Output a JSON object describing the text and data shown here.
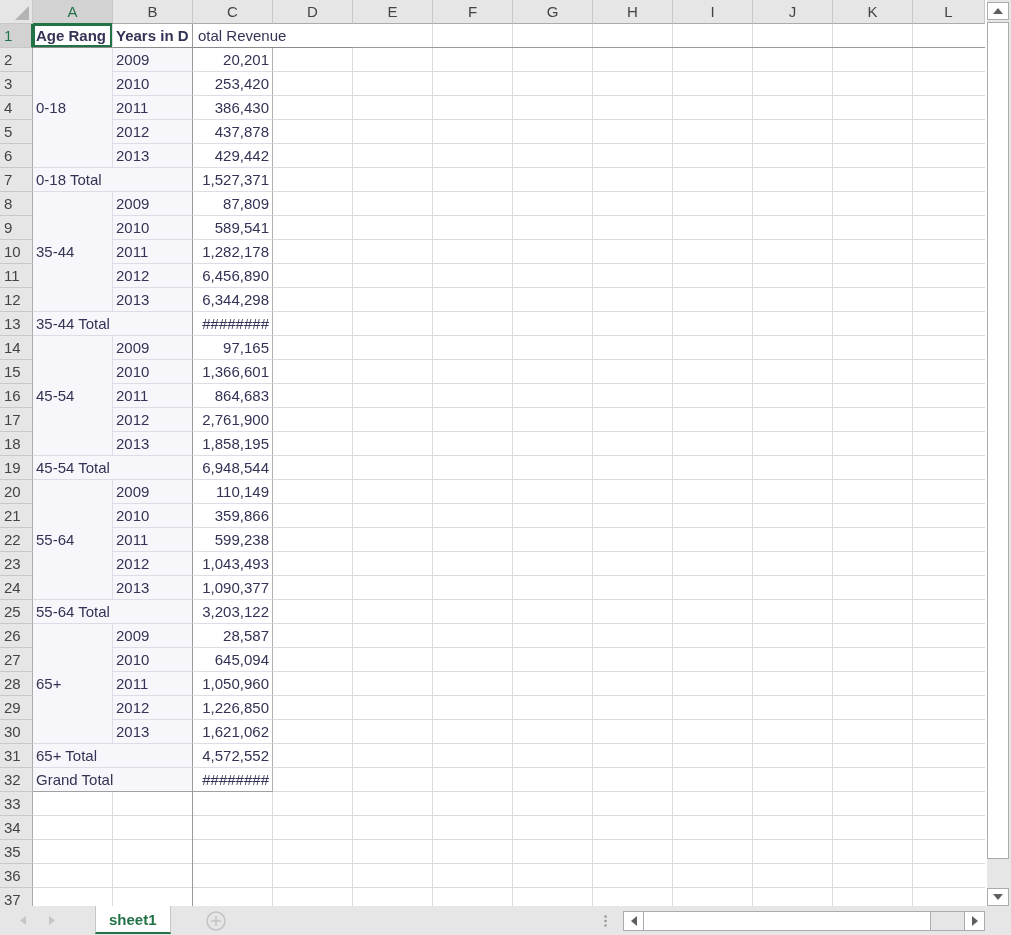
{
  "column_headers": [
    "A",
    "B",
    "C",
    "D",
    "E",
    "F",
    "G",
    "H",
    "I",
    "J",
    "K",
    "L"
  ],
  "header_row": {
    "row_number": "1",
    "cells": [
      {
        "text": "Age Rang",
        "selected": true
      },
      {
        "text": "Years in D",
        "selected": false
      },
      {
        "text": "otal Revenue",
        "selected": false
      }
    ]
  },
  "groups": [
    {
      "label": "0-18",
      "rows": [
        {
          "row_number": "2",
          "year": "2009",
          "value": "20,201"
        },
        {
          "row_number": "3",
          "year": "2010",
          "value": "253,420"
        },
        {
          "row_number": "4",
          "year": "2011",
          "value": "386,430"
        },
        {
          "row_number": "5",
          "year": "2012",
          "value": "437,878"
        },
        {
          "row_number": "6",
          "year": "2013",
          "value": "429,442"
        }
      ],
      "total": {
        "row_number": "7",
        "label": "0-18 Total",
        "value": "1,527,371"
      }
    },
    {
      "label": "35-44",
      "rows": [
        {
          "row_number": "8",
          "year": "2009",
          "value": "87,809"
        },
        {
          "row_number": "9",
          "year": "2010",
          "value": "589,541"
        },
        {
          "row_number": "10",
          "year": "2011",
          "value": "1,282,178"
        },
        {
          "row_number": "11",
          "year": "2012",
          "value": "6,456,890"
        },
        {
          "row_number": "12",
          "year": "2013",
          "value": "6,344,298"
        }
      ],
      "total": {
        "row_number": "13",
        "label": "35-44 Total",
        "value": "########"
      }
    },
    {
      "label": "45-54",
      "rows": [
        {
          "row_number": "14",
          "year": "2009",
          "value": "97,165"
        },
        {
          "row_number": "15",
          "year": "2010",
          "value": "1,366,601"
        },
        {
          "row_number": "16",
          "year": "2011",
          "value": "864,683"
        },
        {
          "row_number": "17",
          "year": "2012",
          "value": "2,761,900"
        },
        {
          "row_number": "18",
          "year": "2013",
          "value": "1,858,195"
        }
      ],
      "total": {
        "row_number": "19",
        "label": "45-54 Total",
        "value": "6,948,544"
      }
    },
    {
      "label": "55-64",
      "rows": [
        {
          "row_number": "20",
          "year": "2009",
          "value": "110,149"
        },
        {
          "row_number": "21",
          "year": "2010",
          "value": "359,866"
        },
        {
          "row_number": "22",
          "year": "2011",
          "value": "599,238"
        },
        {
          "row_number": "23",
          "year": "2012",
          "value": "1,043,493"
        },
        {
          "row_number": "24",
          "year": "2013",
          "value": "1,090,377"
        }
      ],
      "total": {
        "row_number": "25",
        "label": "55-64 Total",
        "value": "3,203,122"
      }
    },
    {
      "label": "65+",
      "rows": [
        {
          "row_number": "26",
          "year": "2009",
          "value": "28,587"
        },
        {
          "row_number": "27",
          "year": "2010",
          "value": "645,094"
        },
        {
          "row_number": "28",
          "year": "2011",
          "value": "1,050,960"
        },
        {
          "row_number": "29",
          "year": "2012",
          "value": "1,226,850"
        },
        {
          "row_number": "30",
          "year": "2013",
          "value": "1,621,062"
        }
      ],
      "total": {
        "row_number": "31",
        "label": "65+ Total",
        "value": "4,572,552"
      }
    }
  ],
  "grand_total": {
    "row_number": "32",
    "label": "Grand Total",
    "value": "########"
  },
  "empty_rows": [
    "33",
    "34",
    "35",
    "36",
    "37"
  ],
  "sheet_tabs": [
    {
      "label": "sheet1",
      "selected": true
    }
  ]
}
